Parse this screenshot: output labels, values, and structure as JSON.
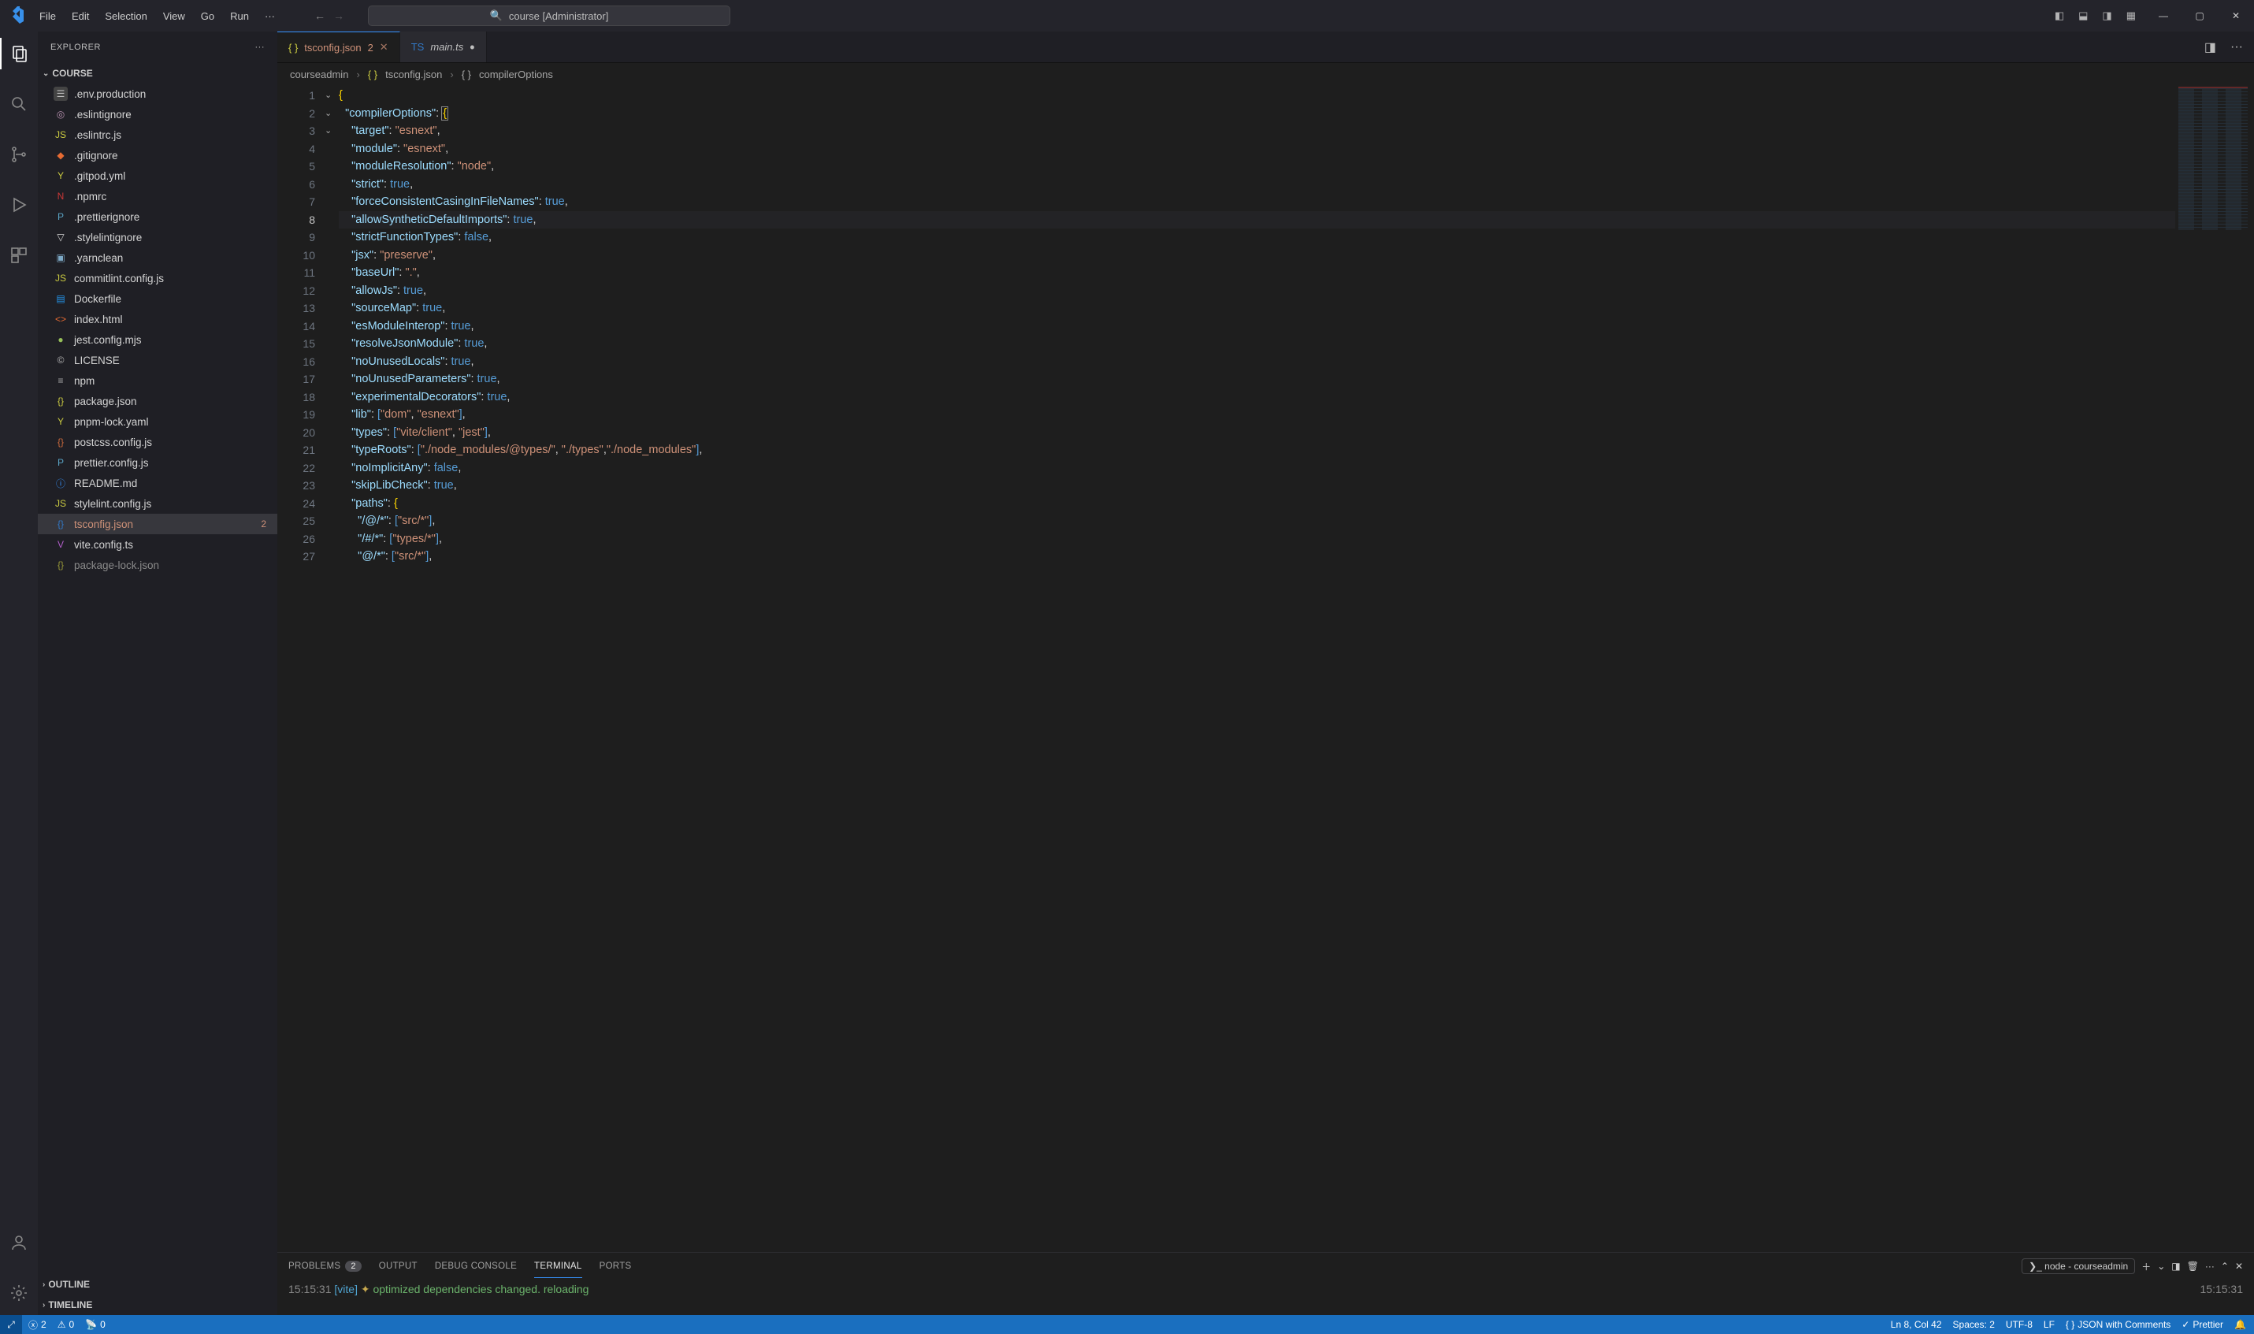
{
  "title": {
    "searchPrefix": "course [Administrator]"
  },
  "menu": [
    "File",
    "Edit",
    "Selection",
    "View",
    "Go",
    "Run"
  ],
  "explorer": {
    "title": "EXPLORER",
    "root": "COURSE",
    "files": [
      {
        "name": ".env.production",
        "icon": "env"
      },
      {
        "name": ".eslintignore",
        "icon": "dot"
      },
      {
        "name": ".eslintrc.js",
        "icon": "js"
      },
      {
        "name": ".gitignore",
        "icon": "git"
      },
      {
        "name": ".gitpod.yml",
        "icon": "yml"
      },
      {
        "name": ".npmrc",
        "icon": "npm"
      },
      {
        "name": ".prettierignore",
        "icon": "pret"
      },
      {
        "name": ".stylelintignore",
        "icon": "style"
      },
      {
        "name": ".yarnclean",
        "icon": "yarn"
      },
      {
        "name": "commitlint.config.js",
        "icon": "js"
      },
      {
        "name": "Dockerfile",
        "icon": "docker"
      },
      {
        "name": "index.html",
        "icon": "html"
      },
      {
        "name": "jest.config.mjs",
        "icon": "jest"
      },
      {
        "name": "LICENSE",
        "icon": "lic"
      },
      {
        "name": "npm",
        "icon": "txt"
      },
      {
        "name": "package.json",
        "icon": "json"
      },
      {
        "name": "pnpm-lock.yaml",
        "icon": "yml"
      },
      {
        "name": "postcss.config.js",
        "icon": "jsonr"
      },
      {
        "name": "prettier.config.js",
        "icon": "pret"
      },
      {
        "name": "README.md",
        "icon": "info"
      },
      {
        "name": "stylelint.config.js",
        "icon": "js"
      },
      {
        "name": "tsconfig.json",
        "icon": "ts",
        "selected": true,
        "warn": true,
        "badge": "2"
      },
      {
        "name": "vite.config.ts",
        "icon": "vite"
      },
      {
        "name": "package-lock.json",
        "icon": "json",
        "muted": true
      }
    ],
    "outline": "OUTLINE",
    "timeline": "TIMELINE"
  },
  "tabs": [
    {
      "name": "tsconfig.json",
      "active": true,
      "problems": "2",
      "icon": "ts"
    },
    {
      "name": "main.ts",
      "active": false,
      "dirty": true,
      "icon": "ts"
    }
  ],
  "breadcrumb": [
    "courseadmin",
    "tsconfig.json",
    "compilerOptions"
  ],
  "code": {
    "lines": [
      "{",
      "  \"compilerOptions\": {",
      "    \"target\": \"esnext\",",
      "    \"module\": \"esnext\",",
      "    \"moduleResolution\": \"node\",",
      "    \"strict\": true,",
      "    \"forceConsistentCasingInFileNames\": true,",
      "    \"allowSyntheticDefaultImports\": true,",
      "    \"strictFunctionTypes\": false,",
      "    \"jsx\": \"preserve\",",
      "    \"baseUrl\": \".\",",
      "    \"allowJs\": true,",
      "    \"sourceMap\": true,",
      "    \"esModuleInterop\": true,",
      "    \"resolveJsonModule\": true,",
      "    \"noUnusedLocals\": true,",
      "    \"noUnusedParameters\": true,",
      "    \"experimentalDecorators\": true,",
      "    \"lib\": [\"dom\", \"esnext\"],",
      "    \"types\": [\"vite/client\", \"jest\"],",
      "    \"typeRoots\": [\"./node_modules/@types/\", \"./types\",\"./node_modules\"],",
      "    \"noImplicitAny\": false,",
      "    \"skipLibCheck\": true,",
      "    \"paths\": {",
      "      \"/@/*\": [\"src/*\"],",
      "      \"/#/*\": [\"types/*\"],",
      "      \"@/*\": [\"src/*\"],"
    ],
    "activeLine": 8
  },
  "panel": {
    "tabs": [
      "PROBLEMS",
      "OUTPUT",
      "DEBUG CONSOLE",
      "TERMINAL",
      "PORTS"
    ],
    "problemsBadge": "2",
    "active": "TERMINAL",
    "termName": "node - courseadmin",
    "log": {
      "time": "15:15:31",
      "tag": "[vite]",
      "spark": "✦",
      "msg": "optimized dependencies changed. reloading",
      "right": "15:15:31"
    }
  },
  "status": {
    "errors": "2",
    "warnings": "0",
    "ports": "0",
    "pos": "Ln 8, Col 42",
    "spaces": "Spaces: 2",
    "enc": "UTF-8",
    "eol": "LF",
    "lang": "JSON with Comments",
    "prettier": "Prettier"
  }
}
